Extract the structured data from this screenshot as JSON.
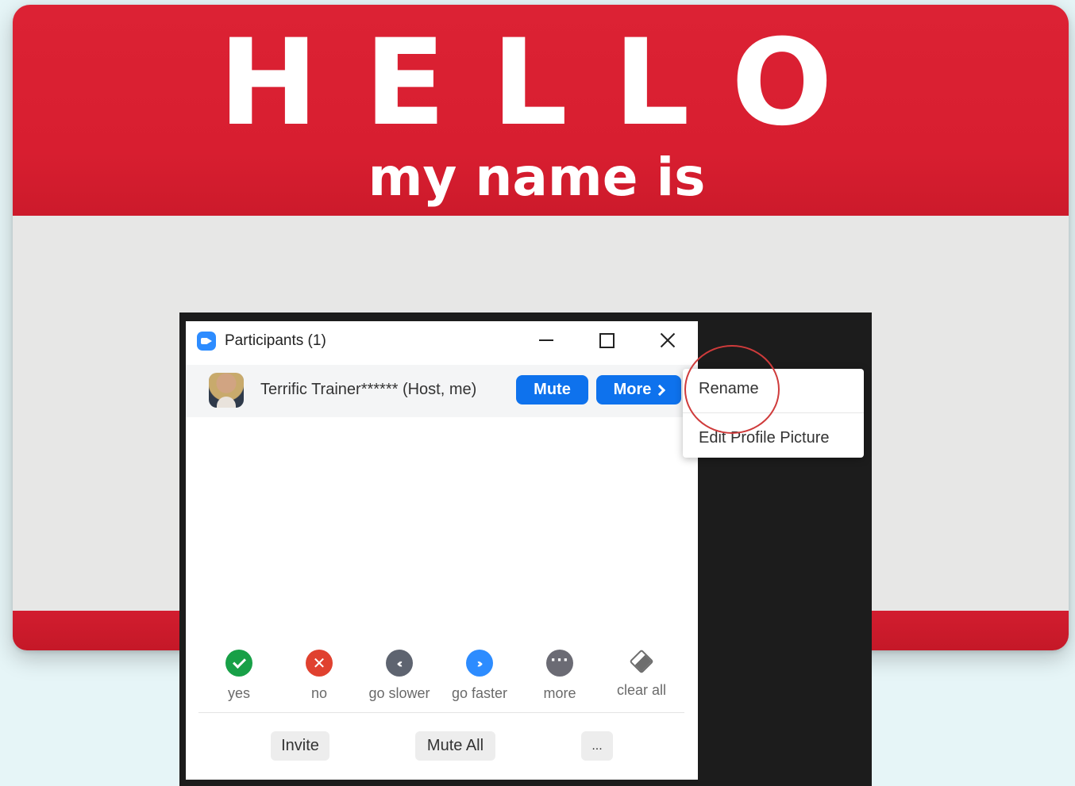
{
  "sticker": {
    "headline": "HELLO",
    "subline": "my name is"
  },
  "window": {
    "title": "Participants (1)",
    "controls": {
      "minimize": "minimize-icon",
      "maximize": "maximize-icon",
      "close": "close-icon"
    }
  },
  "participant": {
    "name": "Terrific Trainer****** (Host, me)",
    "mute_label": "Mute",
    "more_label": "More"
  },
  "feedback": [
    {
      "label": "yes",
      "icon": "check-icon",
      "color": "#18a047"
    },
    {
      "label": "no",
      "icon": "x-icon",
      "color": "#e0412f"
    },
    {
      "label": "go slower",
      "icon": "rewind-icon",
      "color": "#5e6470"
    },
    {
      "label": "go faster",
      "icon": "fast-forward-icon",
      "color": "#2d8cff"
    },
    {
      "label": "more",
      "icon": "ellipsis-icon",
      "color": "#6b6b74"
    },
    {
      "label": "clear all",
      "icon": "eraser-icon",
      "color": "#6e6e6e"
    }
  ],
  "footer": {
    "invite_label": "Invite",
    "mute_all_label": "Mute All",
    "more_label": "..."
  },
  "context_menu": {
    "items": [
      "Rename",
      "Edit Profile Picture"
    ]
  },
  "colors": {
    "sticker_red": "#d81e30",
    "zoom_blue": "#0e72ed",
    "annotation_circle": "#cf3b3b"
  }
}
